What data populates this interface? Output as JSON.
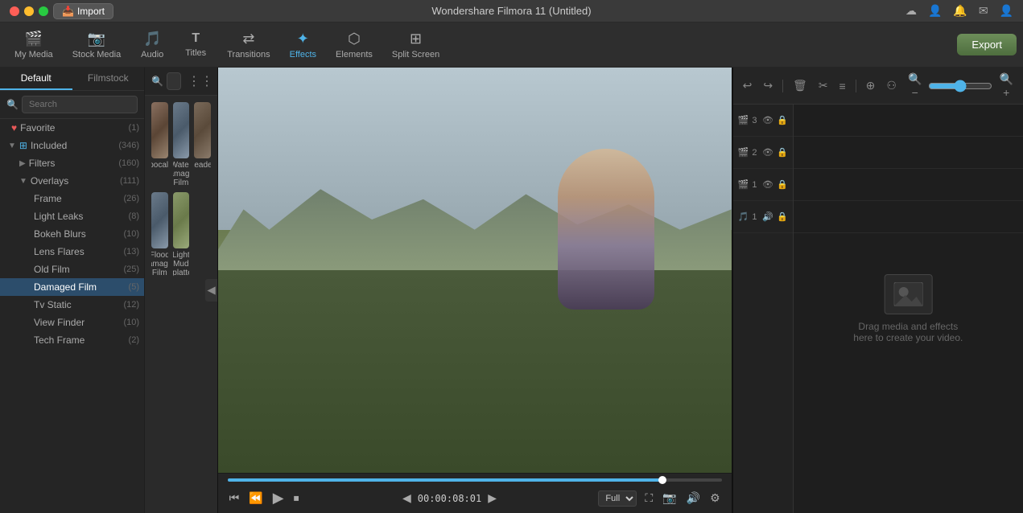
{
  "app": {
    "title": "Wondershare Filmora 11 (Untitled)",
    "import_label": "Import"
  },
  "toolbar": {
    "items": [
      {
        "id": "my-media",
        "label": "My Media",
        "icon": "🎬"
      },
      {
        "id": "stock-media",
        "label": "Stock Media",
        "icon": "📷"
      },
      {
        "id": "audio",
        "label": "Audio",
        "icon": "🎵"
      },
      {
        "id": "titles",
        "label": "Titles",
        "icon": "T"
      },
      {
        "id": "transitions",
        "label": "Transitions",
        "icon": "▶◀"
      },
      {
        "id": "effects",
        "label": "Effects",
        "icon": "✦"
      },
      {
        "id": "elements",
        "label": "Elements",
        "icon": "⬡"
      },
      {
        "id": "split-screen",
        "label": "Split Screen",
        "icon": "⊞"
      }
    ],
    "export_label": "Export"
  },
  "sidebar": {
    "tabs": [
      "Default",
      "Filmstock"
    ],
    "active_tab": "Default",
    "search_placeholder": "Search",
    "tree": [
      {
        "id": "favorite",
        "label": "Favorite",
        "icon": "♥",
        "count": "(1)",
        "level": 0,
        "toggle": "",
        "active": false
      },
      {
        "id": "included",
        "label": "Included",
        "icon": "⊞",
        "count": "(346)",
        "level": 0,
        "toggle": "▼",
        "active": false
      },
      {
        "id": "filters",
        "label": "Filters",
        "icon": "",
        "count": "(160)",
        "level": 1,
        "toggle": "▶",
        "active": false
      },
      {
        "id": "overlays",
        "label": "Overlays",
        "icon": "",
        "count": "(111)",
        "level": 1,
        "toggle": "▼",
        "active": false
      },
      {
        "id": "frame",
        "label": "Frame",
        "icon": "",
        "count": "(26)",
        "level": 2,
        "active": false
      },
      {
        "id": "light-leaks",
        "label": "Light Leaks",
        "icon": "",
        "count": "(8)",
        "level": 2,
        "active": false
      },
      {
        "id": "bokeh-blurs",
        "label": "Bokeh Blurs",
        "icon": "",
        "count": "(10)",
        "level": 2,
        "active": false
      },
      {
        "id": "lens-flares",
        "label": "Lens Flares",
        "icon": "",
        "count": "(13)",
        "level": 2,
        "active": false
      },
      {
        "id": "old-film",
        "label": "Old Film",
        "icon": "",
        "count": "(25)",
        "level": 2,
        "active": false
      },
      {
        "id": "damaged-film",
        "label": "Damaged Film",
        "icon": "",
        "count": "(5)",
        "level": 2,
        "active": true
      },
      {
        "id": "tv-static",
        "label": "Tv Static",
        "icon": "",
        "count": "(12)",
        "level": 2,
        "active": false
      },
      {
        "id": "view-finder",
        "label": "View Finder",
        "icon": "",
        "count": "(10)",
        "level": 2,
        "active": false
      },
      {
        "id": "tech-frame",
        "label": "Tech Frame",
        "icon": "",
        "count": "(2)",
        "level": 2,
        "active": false
      }
    ]
  },
  "effects_grid": {
    "items": [
      {
        "id": "filmpocalypse",
        "label": "Filmpocalypse",
        "thumb": "film-thumb-1"
      },
      {
        "id": "water-damaged",
        "label": "Water Damaged Film",
        "thumb": "film-thumb-2"
      },
      {
        "id": "leader",
        "label": "Leader",
        "thumb": "film-thumb-3"
      },
      {
        "id": "flood-damaged",
        "label": "Flood Damaged Film",
        "thumb": "film-thumb-4"
      },
      {
        "id": "light-mud",
        "label": "Light Mud Splatter",
        "thumb": "film-thumb-5"
      }
    ]
  },
  "preview": {
    "time": "00:00:08:01",
    "quality": "Full",
    "progress_pct": 88,
    "controls": {
      "rewind": "⏮",
      "step_back": "◀◀",
      "play": "▶",
      "stop": "⏹",
      "step_fwd": "◀◀"
    }
  },
  "timeline": {
    "tracks": [
      {
        "id": "track3",
        "num": "3",
        "icon": "🎬"
      },
      {
        "id": "track2",
        "num": "2",
        "icon": "🎬"
      },
      {
        "id": "track1",
        "num": "1",
        "icon": "🎬"
      },
      {
        "id": "audio1",
        "num": "1",
        "icon": "🎵"
      }
    ],
    "drop_text": "Drag media and effects here to create your video."
  }
}
